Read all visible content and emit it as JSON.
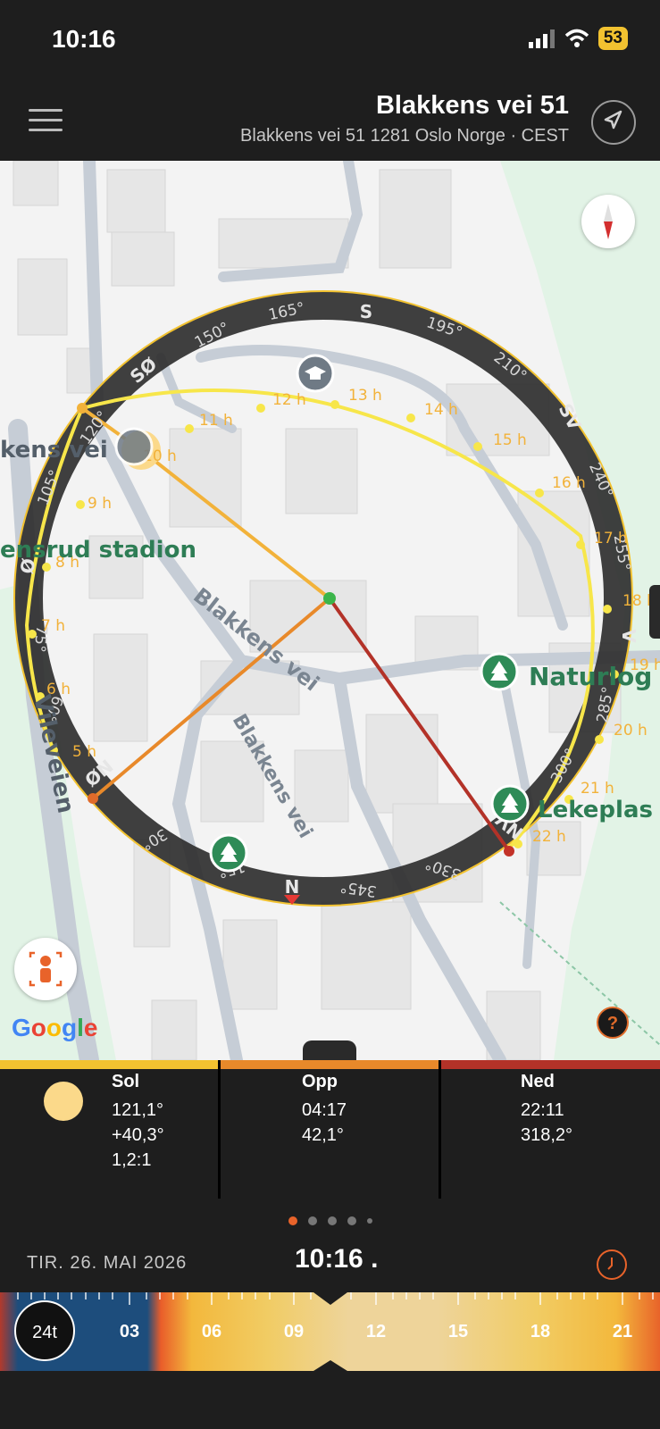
{
  "status_bar": {
    "time": "10:16",
    "battery": "53"
  },
  "header": {
    "title": "Blakkens vei 51",
    "subtitle": "Blakkens vei 51 1281 Oslo Norge · CEST"
  },
  "map": {
    "labels": {
      "street_1": "Blakkens vei",
      "street_2": "Blakkens vei",
      "street_3": "Blakkens vei",
      "stadium": "Holmlia/Svartor Ensrud stadion",
      "stadium_visible": "ensrud stadion",
      "street_left_visible": "kens vei",
      "vileveien": "Vileveien",
      "natur": "Naturlog",
      "lekeplass": "Lekeplas",
      "google": "Google"
    },
    "compass_ring": {
      "direction_labels": [
        "S",
        "SV",
        "V",
        "NV",
        "N",
        "NØ",
        "Ø",
        "SØ"
      ],
      "degree_labels": [
        "150°",
        "165°",
        "195°",
        "210°",
        "240°",
        "255°",
        "285°",
        "300°",
        "330°",
        "345°",
        "15°",
        "30°",
        "60°",
        "75°",
        "105°",
        "120°"
      ]
    },
    "sun_path_hours": [
      "5 h",
      "6 h",
      "7 h",
      "8 h",
      "9 h",
      "10 h",
      "11 h",
      "12 h",
      "13 h",
      "14 h",
      "15 h",
      "16 h",
      "17 h",
      "18 h",
      "19 h",
      "20 h",
      "21 h",
      "22 h"
    ],
    "help_label": "?"
  },
  "info": {
    "sun": {
      "label": "Sol",
      "azimuth": "121,1°",
      "elevation": "+40,3°",
      "ratio": "1,2:1"
    },
    "rise": {
      "label": "Opp",
      "time": "04:17",
      "azimuth": "42,1°"
    },
    "set": {
      "label": "Ned",
      "time": "22:11",
      "azimuth": "318,2°"
    },
    "colors": {
      "sun": "#f2c230",
      "rise": "#e8892a",
      "set": "#b33228"
    }
  },
  "pager": {
    "count": 5,
    "active_index": 0
  },
  "date_row": {
    "date": "TIR. 26. MAI 2026",
    "time": "10:16 ."
  },
  "timeline": {
    "button_24": "24t",
    "ticks": [
      "03",
      "06",
      "09",
      "12",
      "15",
      "18",
      "21"
    ]
  },
  "icons": {
    "menu": "menu-icon",
    "navigate": "navigate-arrow-icon",
    "compass": "compass-icon",
    "person_view": "person-view-icon",
    "clock": "clock-icon",
    "wifi": "wifi-icon",
    "signal": "signal-icon"
  }
}
